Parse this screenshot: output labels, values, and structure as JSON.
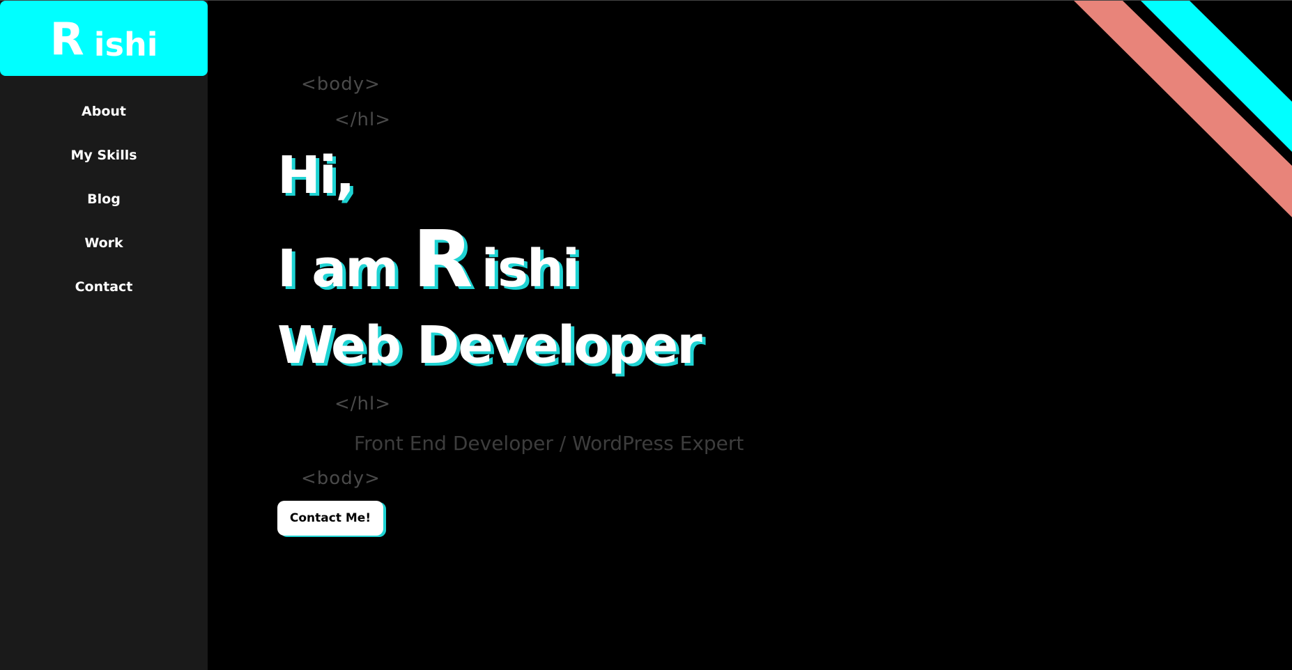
{
  "logo": {
    "initial": "R",
    "rest": "ishi"
  },
  "nav": {
    "items": [
      {
        "label": "About"
      },
      {
        "label": "My Skills"
      },
      {
        "label": "Blog"
      },
      {
        "label": "Work"
      },
      {
        "label": "Contact"
      }
    ]
  },
  "hero": {
    "tag_body_open": "<body>",
    "tag_h1_open": "</hl>",
    "greeting": "Hi,",
    "intro_prefix": "I am",
    "name_initial": "R",
    "name_rest": "ishi",
    "role": "Web Developer",
    "tag_h1_close": "</hl>",
    "subtitle": "Front End Developer / WordPress Expert",
    "tag_body_close": "<body>",
    "cta_label": "Contact Me!"
  },
  "colors": {
    "accent": "#00ffff",
    "accent_shadow": "#1fd3d3",
    "stripe_salmon": "#e8847a",
    "sidebar_bg": "#1a1a1a",
    "page_bg": "#000000"
  }
}
